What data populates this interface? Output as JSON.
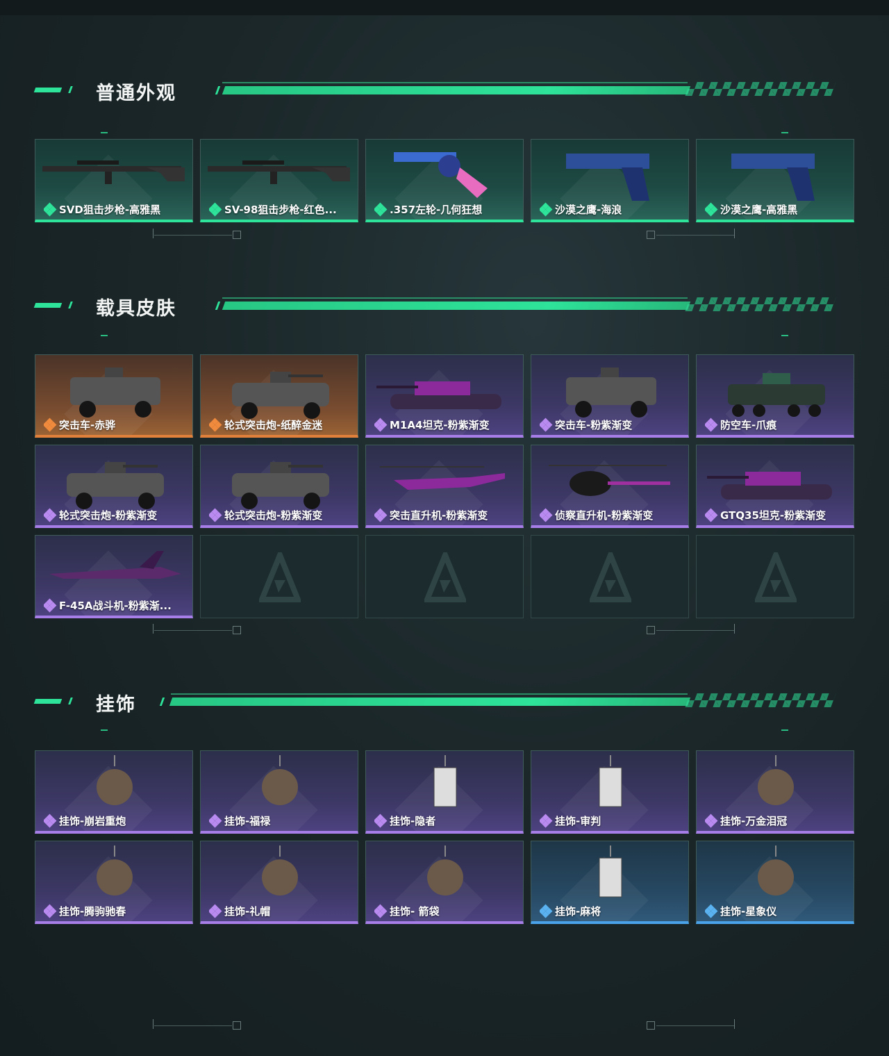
{
  "sections": [
    {
      "title": "普通外观",
      "cards": [
        {
          "label": "SVD狙击步枪-高雅黑",
          "rarity": "green",
          "icon": "sniper-rifle-icon"
        },
        {
          "label": "SV-98狙击步枪-红色...",
          "rarity": "green",
          "icon": "sniper-rifle-icon"
        },
        {
          "label": ".357左轮-几何狂想",
          "rarity": "green",
          "icon": "revolver-icon"
        },
        {
          "label": "沙漠之鹰-海浪",
          "rarity": "green",
          "icon": "pistol-icon"
        },
        {
          "label": "沙漠之鹰-高雅黑",
          "rarity": "green",
          "icon": "pistol-icon"
        }
      ]
    },
    {
      "title": "载具皮肤",
      "cards": [
        {
          "label": "突击车-赤骅",
          "rarity": "orange",
          "icon": "assault-vehicle-icon"
        },
        {
          "label": "轮式突击炮-纸醉金迷",
          "rarity": "orange",
          "icon": "wheeled-gun-icon"
        },
        {
          "label": "M1A4坦克-粉紫渐变",
          "rarity": "purple",
          "icon": "tank-icon"
        },
        {
          "label": "突击车-粉紫渐变",
          "rarity": "purple",
          "icon": "assault-vehicle-icon"
        },
        {
          "label": "防空车-爪痕",
          "rarity": "purple",
          "icon": "aa-vehicle-icon"
        },
        {
          "label": "轮式突击炮-粉紫渐变",
          "rarity": "purple",
          "icon": "wheeled-gun-icon"
        },
        {
          "label": "轮式突击炮-粉紫渐变",
          "rarity": "purple",
          "icon": "wheeled-gun-icon"
        },
        {
          "label": "突击直升机-粉紫渐变",
          "rarity": "purple",
          "icon": "attack-helicopter-icon"
        },
        {
          "label": "侦察直升机-粉紫渐变",
          "rarity": "purple",
          "icon": "scout-helicopter-icon"
        },
        {
          "label": "GTQ35坦克-粉紫渐变",
          "rarity": "purple",
          "icon": "tank-icon"
        },
        {
          "label": "F-45A战斗机-粉紫渐...",
          "rarity": "purple",
          "icon": "fighter-jet-icon"
        },
        {
          "label": "",
          "rarity": "empty",
          "icon": "empty-slot-logo-icon"
        },
        {
          "label": "",
          "rarity": "empty",
          "icon": "empty-slot-logo-icon"
        },
        {
          "label": "",
          "rarity": "empty",
          "icon": "empty-slot-logo-icon"
        },
        {
          "label": "",
          "rarity": "empty",
          "icon": "empty-slot-logo-icon"
        }
      ]
    },
    {
      "title": "挂饰",
      "cards": [
        {
          "label": "挂饰-崩岩重炮",
          "rarity": "purple",
          "icon": "charm-icon"
        },
        {
          "label": "挂饰-福禄",
          "rarity": "purple",
          "icon": "charm-icon"
        },
        {
          "label": "挂饰-隐者",
          "rarity": "purple",
          "icon": "charm-card-icon"
        },
        {
          "label": "挂饰-审判",
          "rarity": "purple",
          "icon": "charm-card-icon"
        },
        {
          "label": "挂饰-万金泪冠",
          "rarity": "purple",
          "icon": "charm-icon"
        },
        {
          "label": "挂饰-腾驹驰春",
          "rarity": "purple",
          "icon": "charm-icon"
        },
        {
          "label": "挂饰-礼帽",
          "rarity": "purple",
          "icon": "charm-icon"
        },
        {
          "label": "挂饰- 箭袋",
          "rarity": "purple",
          "icon": "charm-icon"
        },
        {
          "label": "挂饰-麻将",
          "rarity": "blue",
          "icon": "charm-card-icon"
        },
        {
          "label": "挂饰-星象仪",
          "rarity": "blue",
          "icon": "charm-icon"
        }
      ]
    }
  ],
  "colors": {
    "accent": "#2ee39a",
    "orange": "#e0803a",
    "purple": "#a77de8",
    "blue": "#4aa3e8"
  }
}
